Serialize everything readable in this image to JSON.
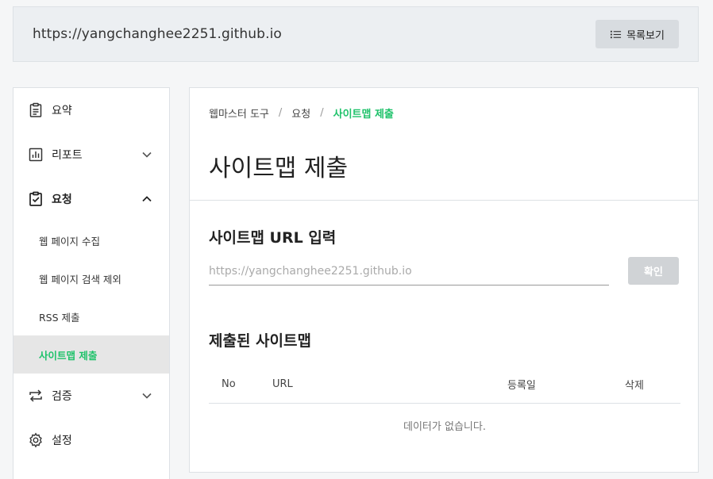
{
  "topbar": {
    "site_url": "https://yangchanghee2251.github.io",
    "list_button_label": "목록보기",
    "list_button_icon": "list-icon"
  },
  "sidebar": {
    "items": [
      {
        "label": "요약",
        "icon": "summary-doc-icon"
      },
      {
        "label": "리포트",
        "icon": "bar-chart-icon",
        "expander": "chevron-down-icon"
      },
      {
        "label": "요청",
        "icon": "clipboard-check-icon",
        "expander": "chevron-up-icon",
        "expanded": true
      },
      {
        "label": "검증",
        "icon": "repeat-arrows-icon",
        "expander": "chevron-down-icon"
      },
      {
        "label": "설정",
        "icon": "gear-icon"
      }
    ],
    "sub_items": [
      {
        "label": "웹 페이지 수집"
      },
      {
        "label": "웹 페이지 검색 제외"
      },
      {
        "label": "RSS 제출"
      },
      {
        "label": "사이트맵 제출",
        "active": true
      }
    ]
  },
  "main": {
    "breadcrumb": [
      "웹마스터 도구",
      "요청",
      "사이트맵 제출"
    ],
    "title": "사이트맵 제출",
    "url_section_title": "사이트맵 URL 입력",
    "url_input_placeholder": "https://yangchanghee2251.github.io",
    "url_input_value": "",
    "confirm_label": "확인",
    "submitted_title": "제출된 사이트맵",
    "table_headers": {
      "no": "No",
      "url": "URL",
      "date": "등록일",
      "delete": "삭제"
    },
    "empty_message": "데이터가 없습니다."
  },
  "colors": {
    "accent_green": "#1ec26a",
    "topbar_bg": "#eceff2",
    "active_sub_bg": "#e6e6e6",
    "confirm_disabled": "#d0d3d6"
  }
}
